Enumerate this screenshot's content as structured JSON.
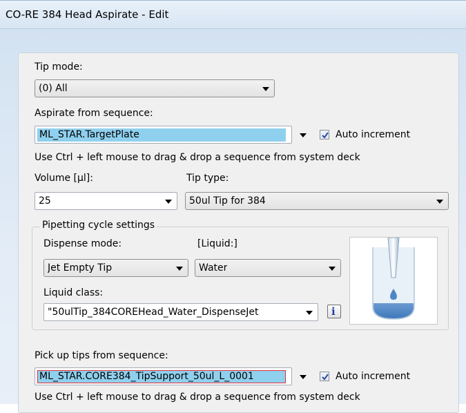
{
  "window": {
    "title": "CO-RE 384 Head Aspirate - Edit"
  },
  "tip_mode": {
    "label": "Tip mode:",
    "value": "(0) All"
  },
  "aspirate_sequence": {
    "label": "Aspirate from sequence:",
    "value": "ML_STAR.TargetPlate",
    "auto_increment_label": "Auto increment",
    "auto_increment_checked": true,
    "hint": "Use Ctrl + left mouse to drag & drop a sequence from system deck"
  },
  "volume": {
    "label": "Volume [µl]:",
    "value": "25"
  },
  "tip_type": {
    "label": "Tip type:",
    "value": "50ul Tip for 384"
  },
  "pipetting_cycle": {
    "legend": "Pipetting cycle settings",
    "dispense_mode_label": "Dispense mode:",
    "dispense_mode_value": "Jet Empty Tip",
    "liquid_label": "[Liquid:]",
    "liquid_value": "Water",
    "liquid_class_label": "Liquid class:",
    "liquid_class_value": "\"50ulTip_384COREHead_Water_DispenseJet",
    "info_icon": "info-icon",
    "image_icon": "tip-in-liquid-icon"
  },
  "pickup_sequence": {
    "label": "Pick up tips from sequence:",
    "value": "ML_STAR.CORE384_TipSupport_50ul_L_0001",
    "auto_increment_label": "Auto increment",
    "auto_increment_checked": true,
    "hint": "Use Ctrl + left mouse to drag & drop a sequence from system deck"
  },
  "colors": {
    "selection": "#8fd0ee",
    "frame": "#d3e2f1",
    "panel": "#f0f0f0",
    "liquid": "#4d86c4"
  }
}
